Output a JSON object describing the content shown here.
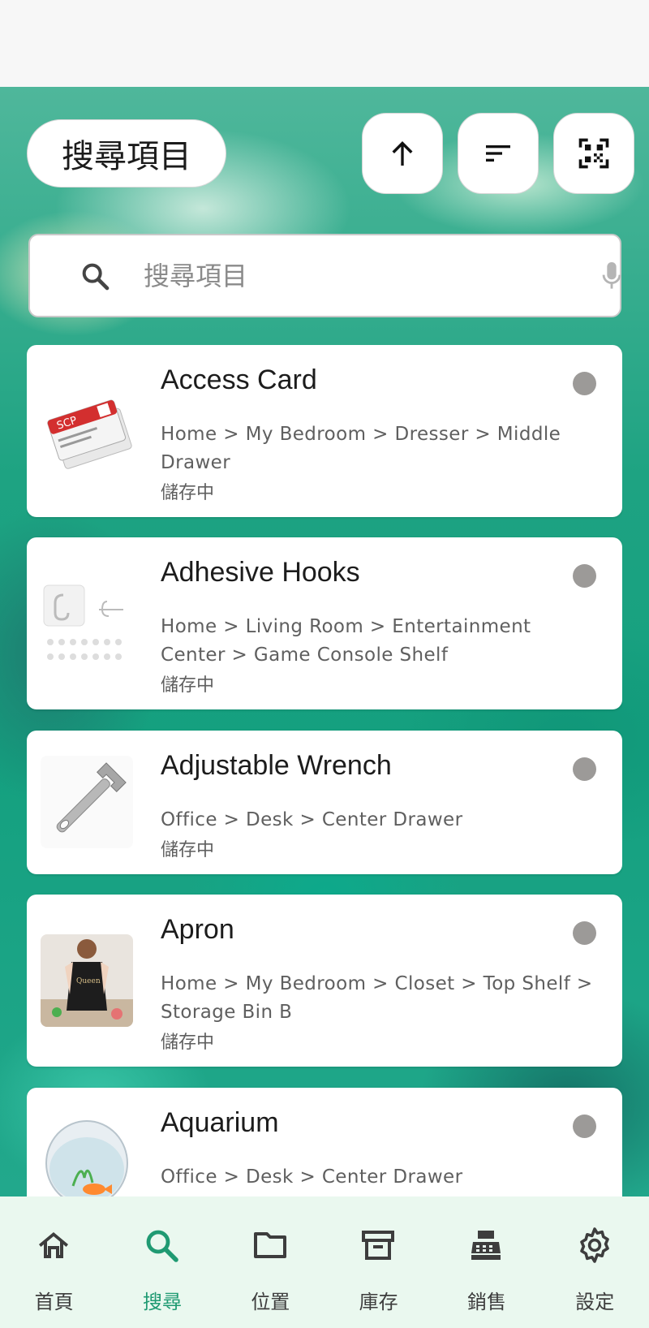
{
  "header": {
    "title": "搜尋項目",
    "sort_direction_icon": "arrow-up-icon",
    "sort_icon": "sort-lines-icon",
    "scan_icon": "qr-scan-icon"
  },
  "search": {
    "placeholder": "搜尋項目",
    "value": ""
  },
  "items": [
    {
      "name": "Access Card",
      "path": "Home > My Bedroom > Dresser > Middle Drawer",
      "status": "儲存中"
    },
    {
      "name": "Adhesive Hooks",
      "path": "Home > Living Room > Entertainment Center > Game Console Shelf",
      "status": "儲存中"
    },
    {
      "name": "Adjustable Wrench",
      "path": "Office > Desk > Center Drawer",
      "status": "儲存中"
    },
    {
      "name": "Apron",
      "path": "Home > My Bedroom > Closet > Top Shelf > Storage Bin B",
      "status": "儲存中"
    },
    {
      "name": "Aquarium",
      "path": "Office > Desk > Center Drawer",
      "status": ""
    }
  ],
  "nav": [
    {
      "label": "首頁",
      "icon": "home-icon"
    },
    {
      "label": "搜尋",
      "icon": "search-icon",
      "active": true
    },
    {
      "label": "位置",
      "icon": "folder-icon"
    },
    {
      "label": "庫存",
      "icon": "archive-icon"
    },
    {
      "label": "銷售",
      "icon": "cash-register-icon"
    },
    {
      "label": "設定",
      "icon": "gear-icon"
    }
  ],
  "colors": {
    "accent": "#1f9a72",
    "nav_background": "#eaf8ef",
    "status_dot": "#9c9a98"
  }
}
